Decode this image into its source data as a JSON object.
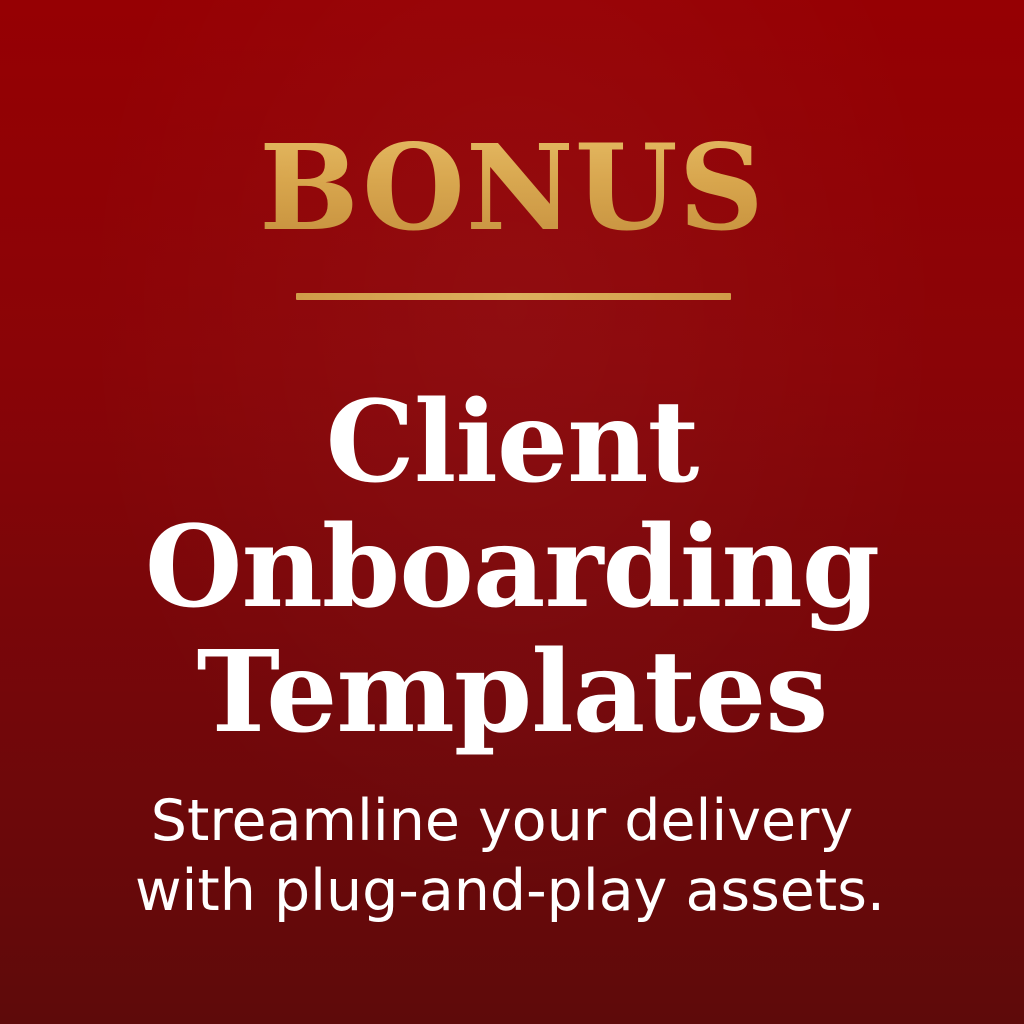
{
  "heading": "BONUS",
  "title": {
    "line1": "Client",
    "line2": "Onboarding",
    "line3": "Templates"
  },
  "subtitle": {
    "line1": "Streamline your delivery",
    "line2": "with plug-and-play assets."
  },
  "colors": {
    "background_top": "#960003",
    "background_bottom": "#5e0a0a",
    "gold": "#d9a646",
    "title_text": "#ffffff"
  }
}
